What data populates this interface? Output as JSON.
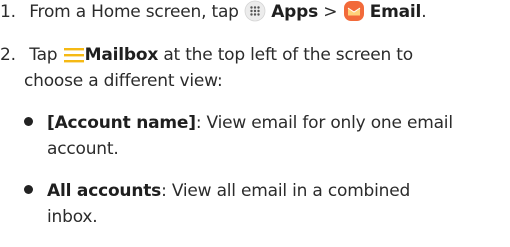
{
  "steps": [
    {
      "number": "1.",
      "text_before": "From a Home screen, tap",
      "apps_label": "Apps",
      "separator": ">",
      "email_label": "Email",
      "end": "."
    },
    {
      "number": "2.",
      "text_before": "Tap",
      "mailbox_label": "Mailbox",
      "text_after_line1": "at the top left of the screen to",
      "text_line2": "choose a different view:"
    }
  ],
  "bullets": [
    {
      "term": "[Account name]",
      "desc_line1": ": View email for only one email",
      "desc_line2": "account."
    },
    {
      "term": "All accounts",
      "desc_line1": ": View all email in a combined",
      "desc_line2": "inbox."
    }
  ],
  "icons": {
    "apps": "apps-grid-icon",
    "email": "email-envelope-icon",
    "mailbox": "hamburger-menu-icon"
  },
  "colors": {
    "accent": "#f5b914",
    "email_icon_bg": "#f26a3a",
    "text": "#2b2b2b"
  }
}
